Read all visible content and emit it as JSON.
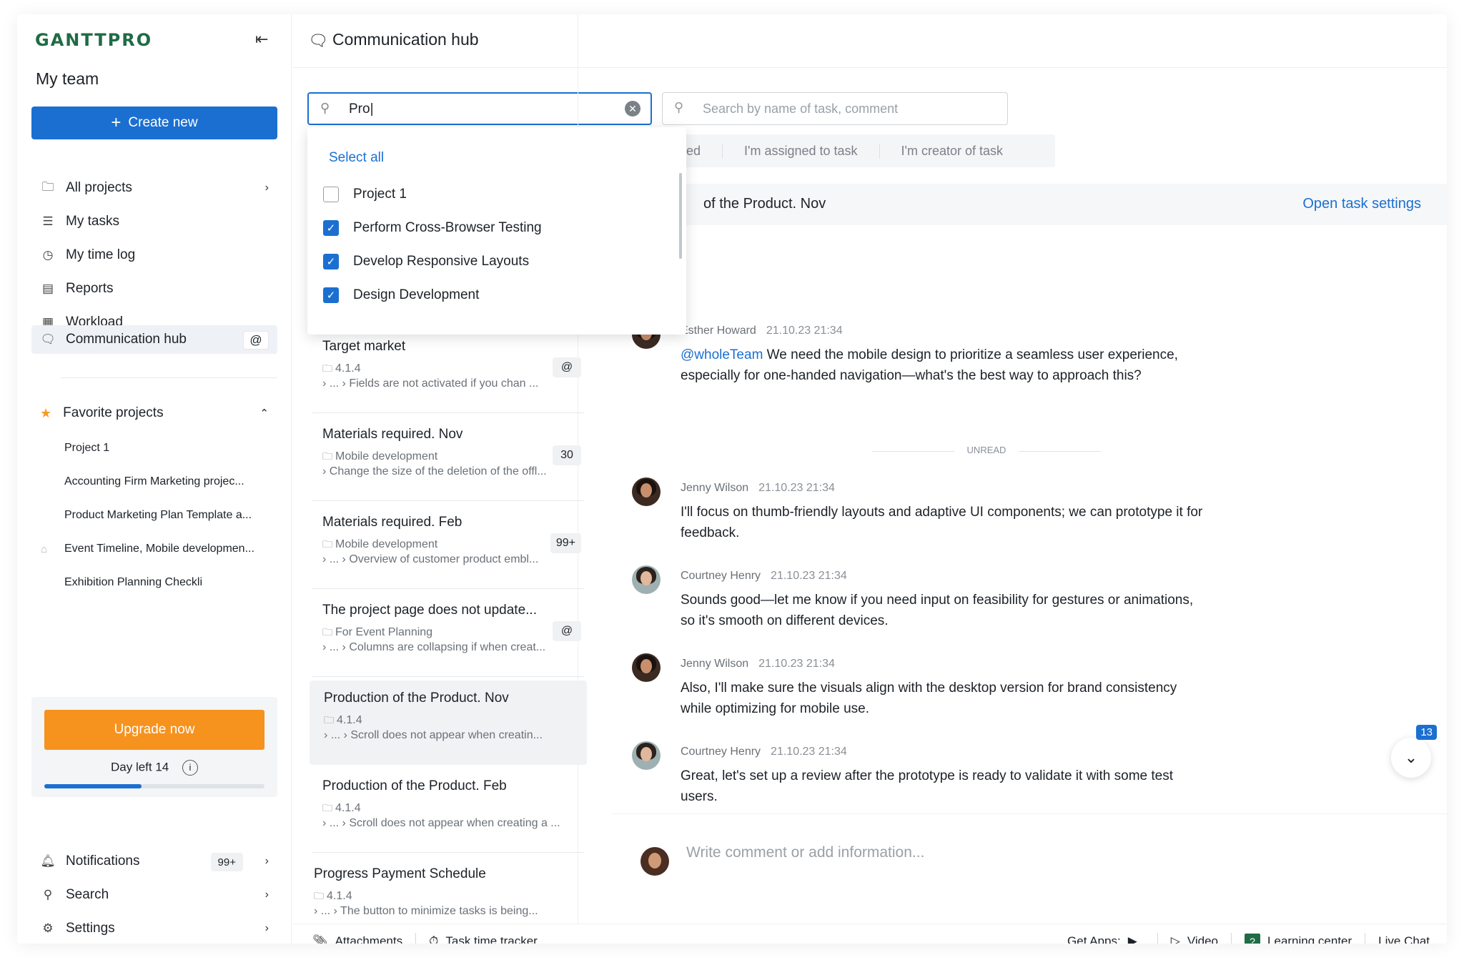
{
  "logo": "GANTTPRO",
  "sidebar": {
    "team": "My team",
    "create_label": "Create new",
    "nav": [
      {
        "label": "All projects"
      },
      {
        "label": "My tasks"
      },
      {
        "label": "My time log"
      },
      {
        "label": "Reports"
      },
      {
        "label": "Workload"
      },
      {
        "label": "Communication hub"
      }
    ],
    "favorites_label": "Favorite projects",
    "favorites": [
      "Project 1",
      "Accounting Firm Marketing projec...",
      "Product Marketing Plan Template a...",
      "Event Timeline, Mobile developmen...",
      "Exhibition Planning Checkli"
    ],
    "upgrade_label": "Upgrade now",
    "day_left": "Day left 14",
    "trial_progress": 0.44,
    "notifications_label": "Notifications",
    "notifications_count": "99+",
    "search_label": "Search",
    "settings_label": "Settings"
  },
  "header": {
    "title": "Communication hub"
  },
  "search": {
    "project_value": "Pro|",
    "task_placeholder": "Search by name of task, comment"
  },
  "filters": [
    "ed",
    "I'm assigned to task",
    "I'm creator of task"
  ],
  "dropdown": {
    "select_all": "Select all",
    "options": [
      {
        "label": "Project 1",
        "checked": false
      },
      {
        "label": "Perform Cross-Browser Testing",
        "checked": true
      },
      {
        "label": "Develop Responsive Layouts",
        "checked": true
      },
      {
        "label": "Design Development",
        "checked": true
      }
    ]
  },
  "tasks": [
    {
      "title": "Target market",
      "project": "4.1.4",
      "sub": "›  ...  ›  Fields are not activated if you chan ...",
      "count": "@"
    },
    {
      "title": "Materials required. Nov",
      "project": "Mobile development",
      "sub": "›  Change the size of the deletion of the offl...",
      "count": "30"
    },
    {
      "title": "Materials required. Feb",
      "project": "Mobile development",
      "sub": "›  ...  ›  Overview of customer product embl...",
      "count": "99+"
    },
    {
      "title": "The project page does not update...",
      "project": "For Event Planning",
      "sub": "›  ...  ›  Columns are collapsing if when creat...",
      "count": "@"
    },
    {
      "title": "Production of the Product. Nov",
      "project": "4.1.4",
      "sub": "›  ...  ›  Scroll does not appear when creatin...",
      "count": ""
    },
    {
      "title": "Production of the Product. Feb",
      "project": "4.1.4",
      "sub": "›  ...  ›  Scroll does not appear when creating a ...",
      "count": ""
    },
    {
      "title": "Progress Payment Schedule",
      "project": "4.1.4",
      "sub": "›  ...  ›  The button to minimize tasks is being...",
      "count": ""
    }
  ],
  "task_header": {
    "title": "of the Product. Nov",
    "open_label": "Open task settings"
  },
  "messages": [
    {
      "name": "Esther Howard",
      "time": "21.10.23 21:34",
      "mention": "@wholeTeam",
      "text": " We need the mobile design to prioritize a seamless user experience, especially for one-handed navigation—what's the best way to approach this?"
    },
    {
      "name": "Jenny Wilson",
      "time": "21.10.23 21:34",
      "mention": "",
      "text": "I'll focus on thumb-friendly layouts and adaptive UI components; we can prototype it for feedback."
    },
    {
      "name": "Courtney Henry",
      "time": "21.10.23 21:34",
      "mention": "",
      "text": "Sounds good—let me know if you need input on feasibility for gestures or animations, so it's smooth on different devices."
    },
    {
      "name": "Jenny Wilson",
      "time": "21.10.23 21:34",
      "mention": "",
      "text": "Also, I'll make sure the visuals align with the desktop version for brand consistency while optimizing for mobile use."
    },
    {
      "name": "Courtney Henry",
      "time": "21.10.23 21:34",
      "mention": "",
      "text": "Great, let's set up a review after the prototype is ready to validate it with some test users."
    }
  ],
  "unread_label": "UNREAD",
  "unread_count": "13",
  "composer_placeholder": "Write comment or add information...",
  "bottom": {
    "attachments": "Attachments",
    "tracker": "Task time tracker",
    "get_apps": "Get Apps:",
    "video": "Video",
    "learning": "Learning center",
    "chat": "Live Chat"
  }
}
